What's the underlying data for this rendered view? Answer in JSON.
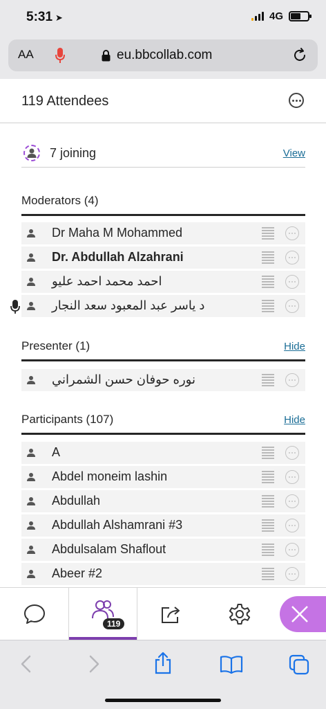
{
  "status": {
    "time": "5:31",
    "network": "4G"
  },
  "safari": {
    "text_size": "AA",
    "url": "eu.bbcollab.com"
  },
  "panel": {
    "title": "119 Attendees",
    "joining": {
      "label": "7 joining",
      "action": "View"
    },
    "moderators": {
      "title": "Moderators (4)",
      "items": [
        {
          "name": "Dr Maha M Mohammed"
        },
        {
          "name": "Dr. Abdullah Alzahrani"
        },
        {
          "name": "احمد محمد احمد عليو"
        },
        {
          "name": "د ياسر عبد المعبود سعد النجار"
        }
      ]
    },
    "presenter": {
      "title": "Presenter (1)",
      "action": "Hide",
      "items": [
        {
          "name": "نوره حوفان حسن الشمراني"
        }
      ]
    },
    "participants": {
      "title": "Participants (107)",
      "action": "Hide",
      "items": [
        {
          "name": "A"
        },
        {
          "name": "Abdel moneim lashin"
        },
        {
          "name": "Abdullah"
        },
        {
          "name": "Abdullah Alshamrani #3"
        },
        {
          "name": "Abdulsalam Shaflout"
        },
        {
          "name": "Abeer #2"
        }
      ]
    }
  },
  "bottom_bar": {
    "attendee_count": "119"
  },
  "colors": {
    "accent": "#7d3fae",
    "link": "#1a6d96",
    "fab": "#c573e4",
    "safari_blue": "#1a73e8"
  }
}
